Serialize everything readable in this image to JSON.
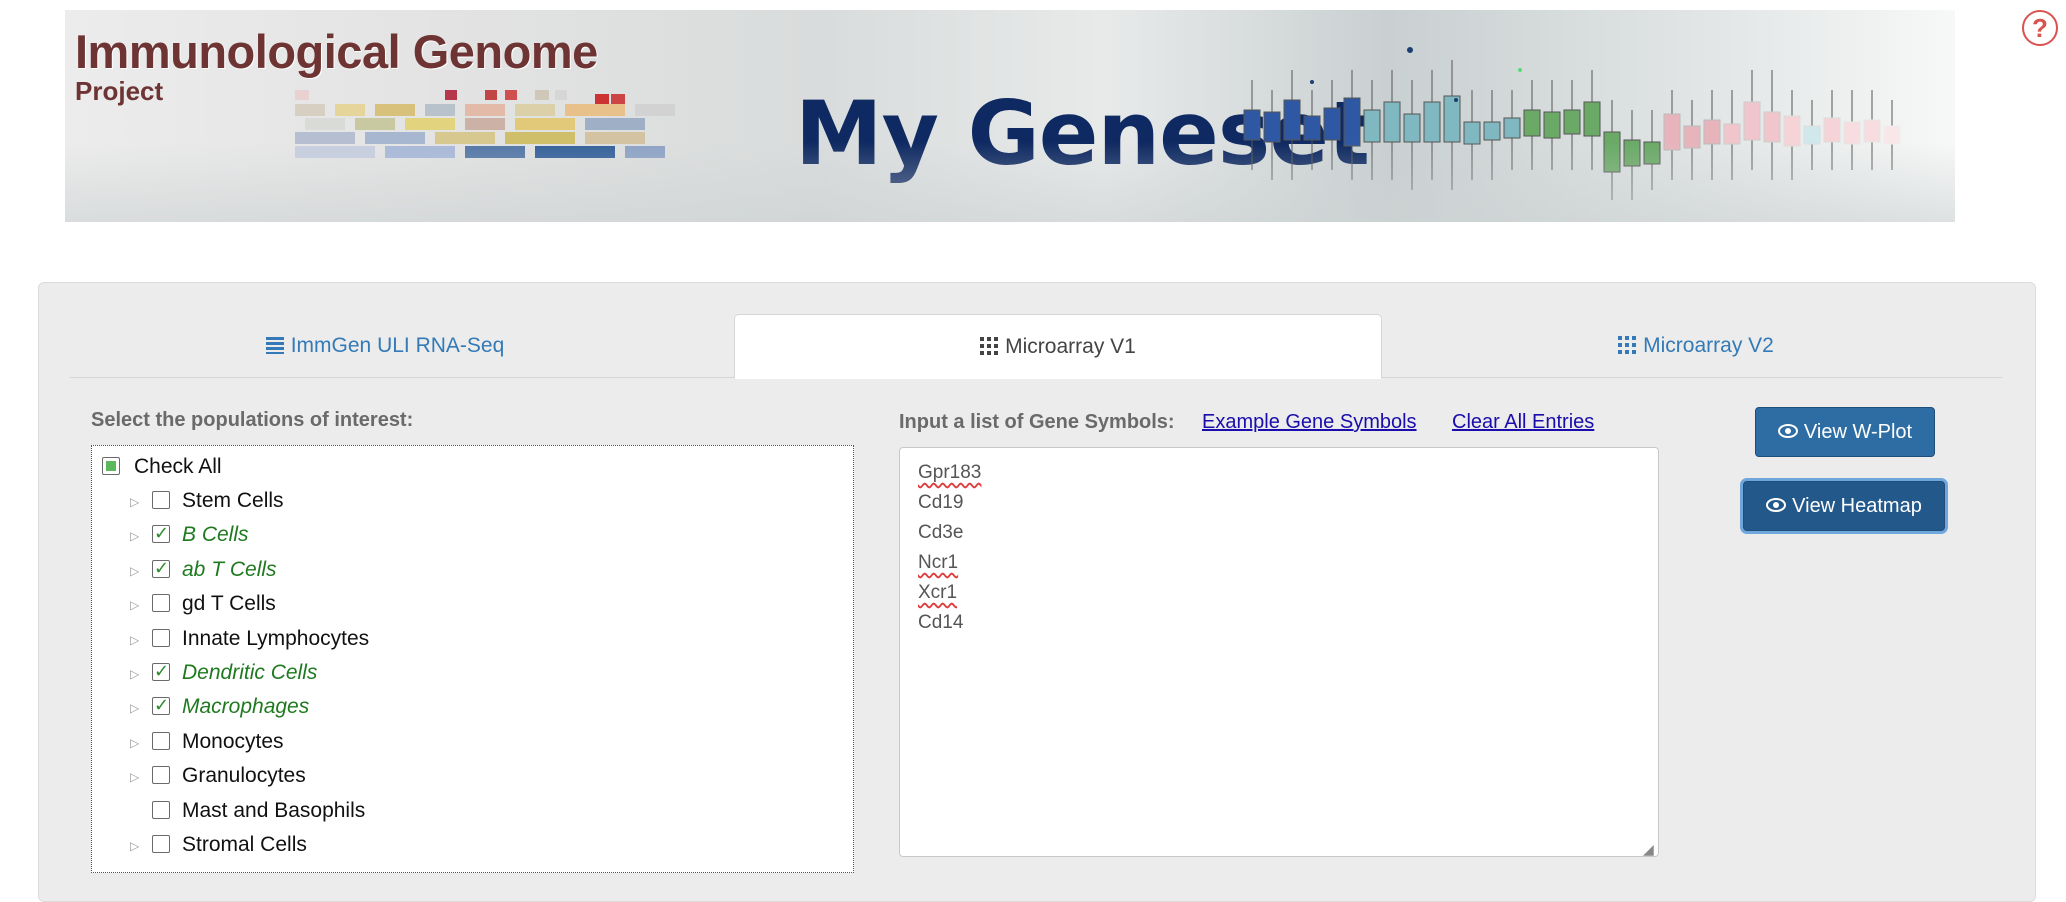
{
  "header": {
    "brand_title": "Immunological Genome",
    "brand_subtitle": "Project",
    "page_title": "My Geneset",
    "help_label": "?"
  },
  "tabs": [
    {
      "label": "ImmGen ULI RNA-Seq",
      "icon": "list-icon",
      "active": false
    },
    {
      "label": "Microarray V1",
      "icon": "grid-icon",
      "active": true
    },
    {
      "label": "Microarray V2",
      "icon": "grid-icon",
      "active": false
    }
  ],
  "populations": {
    "label": "Select the populations of interest:",
    "check_all_label": "Check All",
    "items": [
      {
        "label": "Stem Cells",
        "checked": false,
        "expandable": true
      },
      {
        "label": "B Cells",
        "checked": true,
        "expandable": true
      },
      {
        "label": "ab T Cells",
        "checked": true,
        "expandable": true
      },
      {
        "label": "gd T Cells",
        "checked": false,
        "expandable": true
      },
      {
        "label": "Innate Lymphocytes",
        "checked": false,
        "expandable": true
      },
      {
        "label": "Dendritic Cells",
        "checked": true,
        "expandable": true
      },
      {
        "label": "Macrophages",
        "checked": true,
        "expandable": true
      },
      {
        "label": "Monocytes",
        "checked": false,
        "expandable": true
      },
      {
        "label": "Granulocytes",
        "checked": false,
        "expandable": true
      },
      {
        "label": "Mast and Basophils",
        "checked": false,
        "expandable": false
      },
      {
        "label": "Stromal Cells",
        "checked": false,
        "expandable": true
      }
    ]
  },
  "gene_input": {
    "label": "Input a list of Gene Symbols:",
    "example_link": "Example Gene Symbols",
    "clear_link": "Clear All Entries",
    "genes": [
      "Gpr183",
      "Cd19",
      "Cd3e",
      "Ncr1",
      "Xcr1",
      "Cd14"
    ]
  },
  "buttons": {
    "wplot": "View W-Plot",
    "heatmap": "View Heatmap"
  },
  "colors": {
    "accent": "#337ab7",
    "button": "#2e6da4",
    "selected_text": "#1f7a1f",
    "title": "#0f2a62",
    "brand": "#6e3434"
  }
}
